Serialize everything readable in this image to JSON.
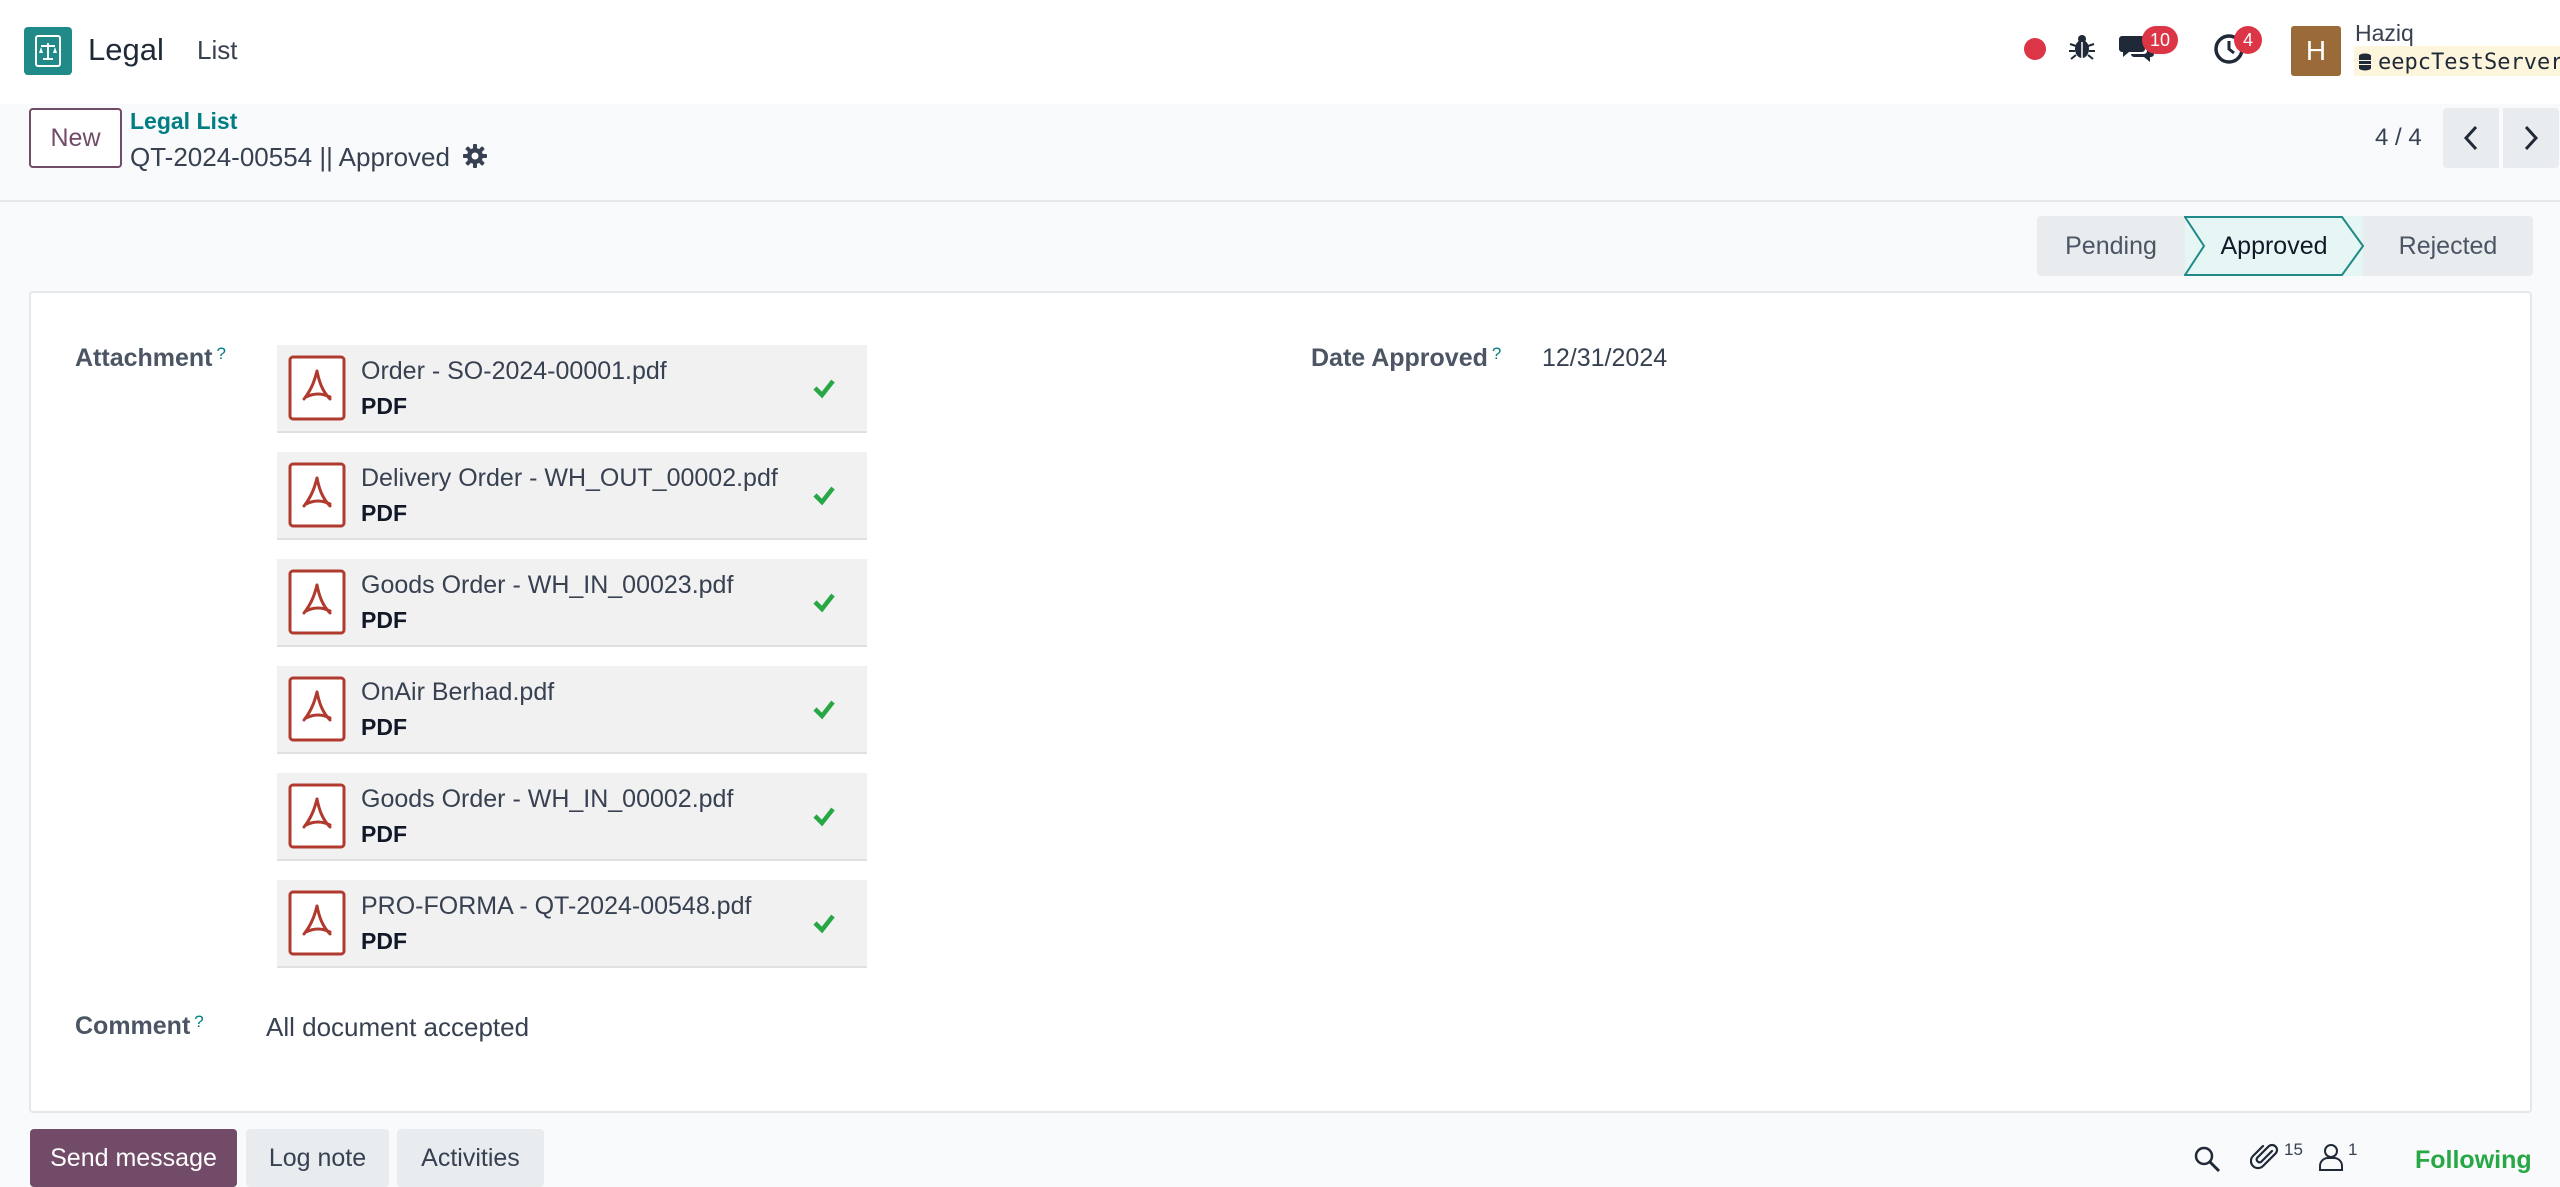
{
  "app": {
    "name": "Legal",
    "menu_list": "List",
    "icon": "scale-balance-icon"
  },
  "systray": {
    "chat_count": "10",
    "activity_count": "4",
    "user_initial": "H",
    "user_name": "Haziq",
    "database": "eepcTestServer"
  },
  "control_panel": {
    "new_label": "New",
    "breadcrumb": "Legal List",
    "record_title": "QT-2024-00554 || Approved",
    "pager": "4 / 4"
  },
  "statusbar": {
    "stages": [
      "Pending",
      "Approved",
      "Rejected"
    ],
    "active": "Approved"
  },
  "form": {
    "attachment_label": "Attachment",
    "help_mark": "?",
    "attachments": [
      {
        "name": "Order - SO-2024-00001.pdf",
        "type": "PDF"
      },
      {
        "name": "Delivery Order - WH_OUT_00002.pdf",
        "type": "PDF"
      },
      {
        "name": "Goods Order - WH_IN_00023.pdf",
        "type": "PDF"
      },
      {
        "name": "OnAir Berhad.pdf",
        "type": "PDF"
      },
      {
        "name": "Goods Order - WH_IN_00002.pdf",
        "type": "PDF"
      },
      {
        "name": "PRO-FORMA - QT-2024-00548.pdf",
        "type": "PDF"
      }
    ],
    "date_approved_label": "Date Approved",
    "date_approved_value": "12/31/2024",
    "comment_label": "Comment",
    "comment_value": "All document accepted"
  },
  "chatter": {
    "send_message": "Send message",
    "log_note": "Log note",
    "activities": "Activities",
    "attachment_count": "15",
    "follower_count": "1",
    "following": "Following"
  },
  "colors": {
    "brand": "#714b67",
    "app_icon": "#1f8a87",
    "link": "#017e84",
    "badge": "#dc3545",
    "success": "#28a745",
    "pdf": "#b03a2e"
  }
}
